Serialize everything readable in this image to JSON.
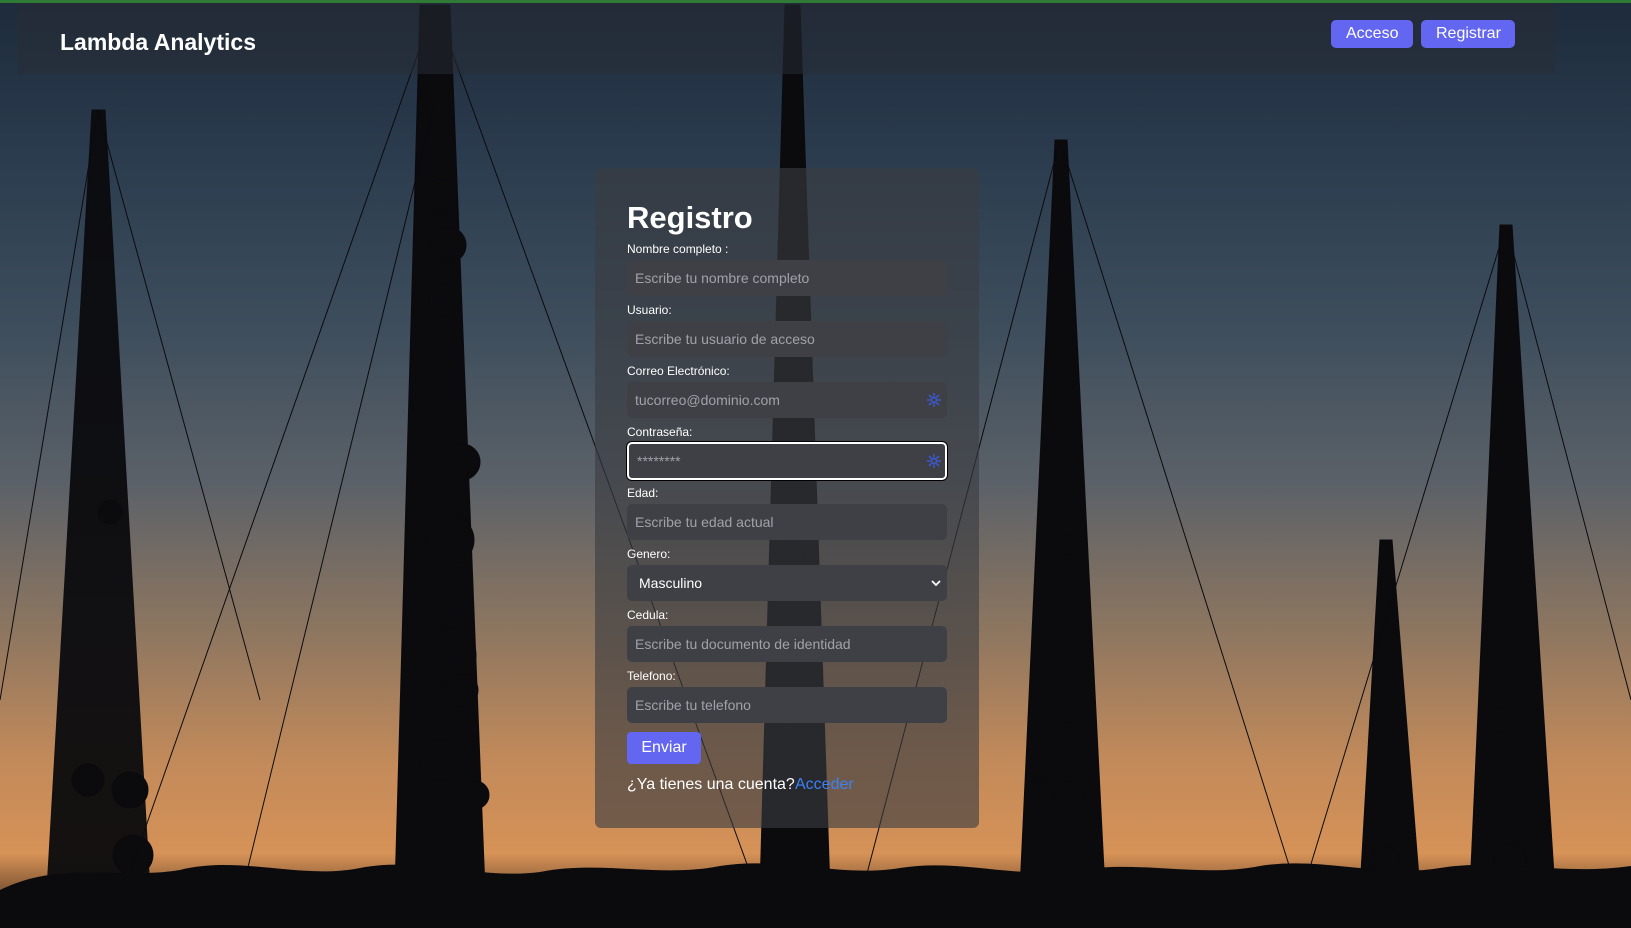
{
  "brand": "Lambda Analytics",
  "nav": {
    "login_label": "Acceso",
    "register_label": "Registrar"
  },
  "form": {
    "title": "Registro",
    "fields": [
      {
        "label": "Nombre completo :",
        "placeholder": "Escribe tu nombre completo"
      },
      {
        "label": "Usuario:",
        "placeholder": "Escribe tu usuario de acceso"
      },
      {
        "label": "Correo Electrónico:",
        "placeholder": "tucorreo@dominio.com"
      },
      {
        "label": "Contraseña:",
        "placeholder": "********"
      },
      {
        "label": "Edad:",
        "placeholder": "Escribe tu edad actual"
      },
      {
        "label": "Genero:",
        "selected": "Masculino"
      },
      {
        "label": "Cedula:",
        "placeholder": "Escribe tu documento de identidad"
      },
      {
        "label": "Telefono:",
        "placeholder": "Escribe tu telefono"
      }
    ],
    "submit_label": "Enviar",
    "footer_question": "¿Ya tienes una cuenta?",
    "footer_link": "Acceder"
  },
  "colors": {
    "accent": "#6366f1",
    "link": "#3b82f6",
    "topline": "#2f7a35"
  },
  "icons": {
    "field_autofill": "autofill-icon",
    "select_arrow": "chevron-down-icon"
  }
}
